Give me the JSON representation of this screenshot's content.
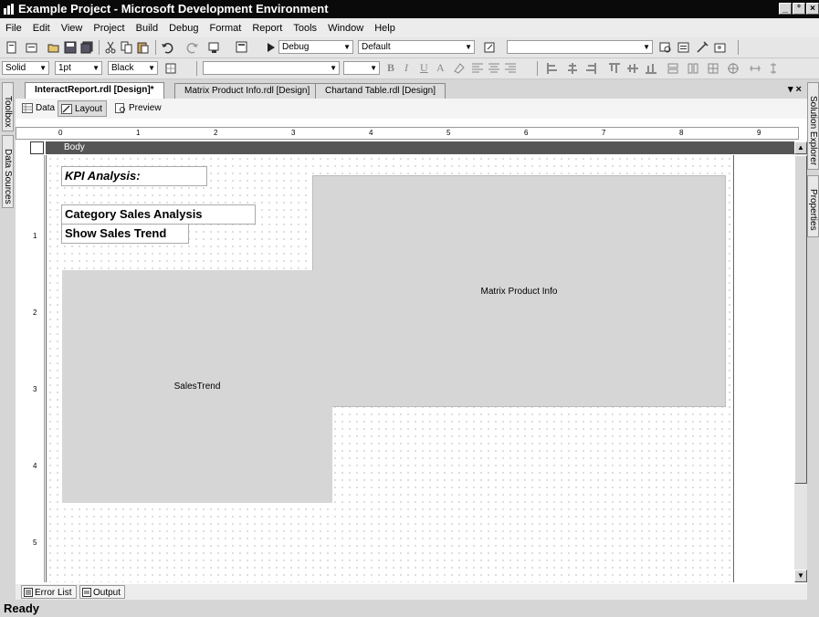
{
  "window": {
    "title": "Example Project - Microsoft Development Environment",
    "controls": [
      "_",
      "°",
      "×"
    ]
  },
  "menu": [
    "File",
    "Edit",
    "View",
    "Project",
    "Build",
    "Debug",
    "Format",
    "Report",
    "Tools",
    "Window",
    "Help"
  ],
  "toolbar1": {
    "config": "Debug",
    "platform": "Default"
  },
  "toolbar2": {
    "line_style": "Solid",
    "line_width": "1pt",
    "color": "Black"
  },
  "doc_tabs": [
    {
      "label": "InteractReport.rdl [Design]*",
      "active": true
    },
    {
      "label": "Matrix Product Info.rdl [Design]",
      "active": false
    },
    {
      "label": "Chartand Table.rdl [Design]",
      "active": false
    }
  ],
  "doc_controls": "▾ ×",
  "view_tabs": [
    {
      "label": "Data",
      "active": false
    },
    {
      "label": "Layout",
      "active": true
    },
    {
      "label": "Preview",
      "active": false
    }
  ],
  "side_tabs": {
    "toolbox": "Toolbox",
    "data_sources": "Data Sources",
    "solution_explorer": "Solution Explorer",
    "properties": "Properties"
  },
  "ruler": {
    "h": [
      "0",
      "1",
      "2",
      "3",
      "4",
      "5",
      "6",
      "7",
      "8",
      "9"
    ],
    "v": [
      "1",
      "2",
      "3",
      "4",
      "5"
    ]
  },
  "body_label": "Body",
  "report_items": {
    "kpi": "KPI Analysis:",
    "category": "Category Sales Analysis",
    "trend": "Show Sales Trend",
    "matrix": "Matrix Product Info",
    "salestrend": "SalesTrend"
  },
  "bottom_tabs": [
    "Error List",
    "Output"
  ],
  "status": "Ready"
}
